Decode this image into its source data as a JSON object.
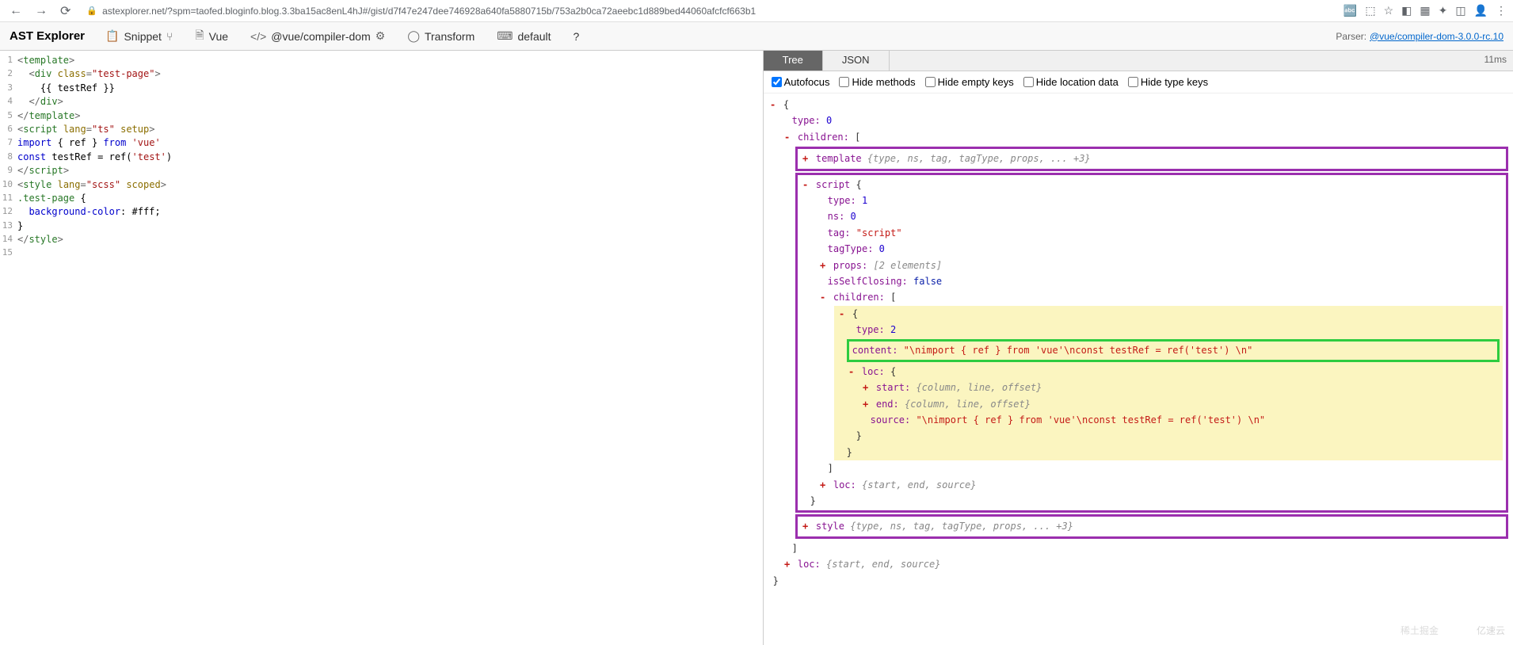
{
  "browser": {
    "url": "astexplorer.net/?spm=taofed.bloginfo.blog.3.3ba15ac8enL4hJ#/gist/d7f47e247dee746928a640fa5880715b/753a2b0ca72aeebc1d889bed44060afcfcf663b1"
  },
  "toolbar": {
    "brand": "AST Explorer",
    "snippet": "Snippet",
    "lang": "Vue",
    "compiler": "@vue/compiler-dom",
    "transform": "Transform",
    "default": "default",
    "help": "?",
    "parser_label": "Parser:",
    "parser_link": "@vue/compiler-dom-3.0.0-rc.10"
  },
  "code": {
    "lines": [
      {
        "n": "1",
        "html": "<span class='kw-punc'>&lt;</span><span class='kw-tag'>template</span><span class='kw-punc'>&gt;</span>"
      },
      {
        "n": "2",
        "html": "  <span class='kw-punc'>&lt;</span><span class='kw-tag'>div</span> <span class='kw-attr'>class</span><span class='kw-punc'>=</span><span class='kw-str'>\"test-page\"</span><span class='kw-punc'>&gt;</span>"
      },
      {
        "n": "3",
        "html": "    <span class='kw-plain'>{{ testRef }}</span>"
      },
      {
        "n": "4",
        "html": "  <span class='kw-punc'>&lt;/</span><span class='kw-tag'>div</span><span class='kw-punc'>&gt;</span>"
      },
      {
        "n": "5",
        "html": "<span class='kw-punc'>&lt;/</span><span class='kw-tag'>template</span><span class='kw-punc'>&gt;</span>"
      },
      {
        "n": "6",
        "html": "<span class='kw-punc'>&lt;</span><span class='kw-tag'>script</span> <span class='kw-attr'>lang</span><span class='kw-punc'>=</span><span class='kw-str'>\"ts\"</span> <span class='kw-attr'>setup</span><span class='kw-punc'>&gt;</span>"
      },
      {
        "n": "7",
        "html": "<span class='kw-fn'>import</span> <span class='kw-plain'>{ ref }</span> <span class='kw-fn'>from</span> <span class='kw-str'>'vue'</span>"
      },
      {
        "n": "8",
        "html": "<span class='kw-fn'>const</span> <span class='kw-plain'>testRef = ref(</span><span class='kw-str'>'test'</span><span class='kw-plain'>)</span>"
      },
      {
        "n": "9",
        "html": "<span class='kw-punc'>&lt;/</span><span class='kw-tag'>script</span><span class='kw-punc'>&gt;</span>"
      },
      {
        "n": "10",
        "html": "<span class='kw-punc'>&lt;</span><span class='kw-tag'>style</span> <span class='kw-attr'>lang</span><span class='kw-punc'>=</span><span class='kw-str'>\"scss\"</span> <span class='kw-attr'>scoped</span><span class='kw-punc'>&gt;</span>"
      },
      {
        "n": "11",
        "html": "<span class='kw-tag'>.test-page</span> <span class='kw-plain'>{</span>"
      },
      {
        "n": "12",
        "html": "  <span class='kw-fn'>background-color</span><span class='kw-plain'>: </span><span class='kw-plain'>#fff;</span>"
      },
      {
        "n": "13",
        "html": "<span class='kw-plain'>}</span>"
      },
      {
        "n": "14",
        "html": "<span class='kw-punc'>&lt;/</span><span class='kw-tag'>style</span><span class='kw-punc'>&gt;</span>"
      },
      {
        "n": "15",
        "html": ""
      }
    ]
  },
  "right": {
    "tabs": {
      "tree": "Tree",
      "json": "JSON"
    },
    "timing": "11ms",
    "options": {
      "autofocus": "Autofocus",
      "hide_methods": "Hide methods",
      "hide_empty": "Hide empty keys",
      "hide_loc": "Hide location data",
      "hide_type": "Hide type keys"
    }
  },
  "tree": {
    "root_open": "{",
    "type0": {
      "k": "type:",
      "v": "0"
    },
    "children_k": "children:",
    "bracket_open": "[",
    "template": {
      "k": "template",
      "summary": "{type, ns, tag, tagType, props, ... +3}"
    },
    "script": {
      "k": "script",
      "brace": "{",
      "type": {
        "k": "type:",
        "v": "1"
      },
      "ns": {
        "k": "ns:",
        "v": "0"
      },
      "tag": {
        "k": "tag:",
        "v": "\"script\""
      },
      "tagType": {
        "k": "tagType:",
        "v": "0"
      },
      "props": {
        "k": "props:",
        "summary": "[2 elements]"
      },
      "isSelfClosing": {
        "k": "isSelfClosing:",
        "v": "false"
      },
      "children": {
        "k": "children:",
        "bracket": "[",
        "item_brace": "{",
        "type": {
          "k": "type:",
          "v": "2"
        },
        "content": {
          "k": "content:",
          "v": "\"\\nimport { ref } from 'vue'\\nconst testRef = ref('test')  \\n\""
        },
        "loc": {
          "k": "loc:",
          "brace": "{",
          "start": {
            "k": "start:",
            "summary": "{column, line, offset}"
          },
          "end": {
            "k": "end:",
            "summary": "{column, line, offset}"
          },
          "source": {
            "k": "source:",
            "v": "\"\\nimport { ref } from 'vue'\\nconst testRef = ref('test')  \\n\""
          }
        }
      },
      "loc": {
        "k": "loc:",
        "summary": "{start, end, source}"
      }
    },
    "style": {
      "k": "style",
      "summary": "{type, ns, tag, tagType, props, ... +3}"
    },
    "outer_loc": {
      "k": "loc:",
      "summary": "{start, end, source}"
    }
  },
  "watermark1": "稀土掘金",
  "watermark2": "亿速云"
}
